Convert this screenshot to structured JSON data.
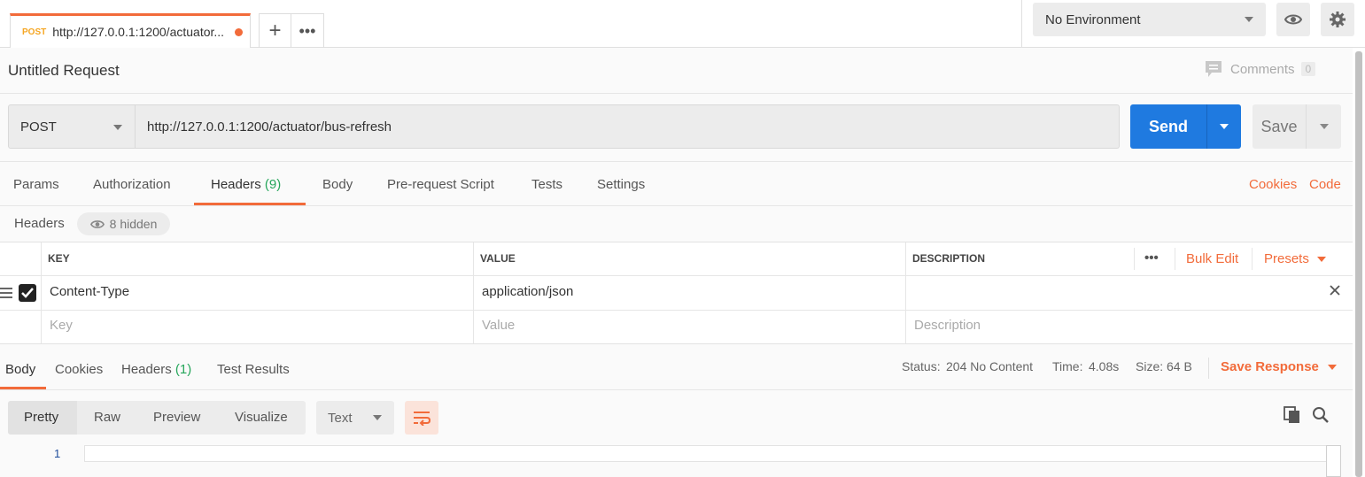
{
  "tabs": {
    "active": {
      "method": "POST",
      "url": "http://127.0.0.1:1200/actuator..."
    },
    "add_label": "+",
    "more_label": "•••"
  },
  "environment": {
    "selected": "No Environment"
  },
  "request": {
    "title": "Untitled Request",
    "comments_label": "Comments",
    "comments_count": "0",
    "method": "POST",
    "url": "http://127.0.0.1:1200/actuator/bus-refresh",
    "send_label": "Send",
    "save_label": "Save"
  },
  "request_tabs": {
    "params": "Params",
    "authorization": "Authorization",
    "headers": "Headers",
    "headers_count": "(9)",
    "body": "Body",
    "pre_request": "Pre-request Script",
    "tests": "Tests",
    "settings": "Settings",
    "cookies": "Cookies",
    "code": "Code"
  },
  "headers_section": {
    "label": "Headers",
    "hidden": "8 hidden",
    "columns": {
      "key": "KEY",
      "value": "VALUE",
      "description": "DESCRIPTION"
    },
    "more": "•••",
    "bulk_edit": "Bulk Edit",
    "presets": "Presets",
    "rows": [
      {
        "key": "Content-Type",
        "value": "application/json",
        "description": "",
        "checked": true
      }
    ],
    "placeholders": {
      "key": "Key",
      "value": "Value",
      "description": "Description"
    }
  },
  "response": {
    "tabs": {
      "body": "Body",
      "cookies": "Cookies",
      "headers": "Headers",
      "headers_count": "(1)",
      "test_results": "Test Results"
    },
    "status_label": "Status:",
    "status_value": "204 No Content",
    "time_label": "Time:",
    "time_value": "4.08s",
    "size_label": "Size:",
    "size_value": "64 B",
    "save_response": "Save Response",
    "view_modes": [
      "Pretty",
      "Raw",
      "Preview",
      "Visualize"
    ],
    "format": "Text",
    "line_numbers": [
      "1"
    ]
  },
  "colors": {
    "accent": "#f26b3a",
    "send": "#1f7ae0",
    "success": "#26a65b",
    "method_badge": "#f5a623"
  }
}
